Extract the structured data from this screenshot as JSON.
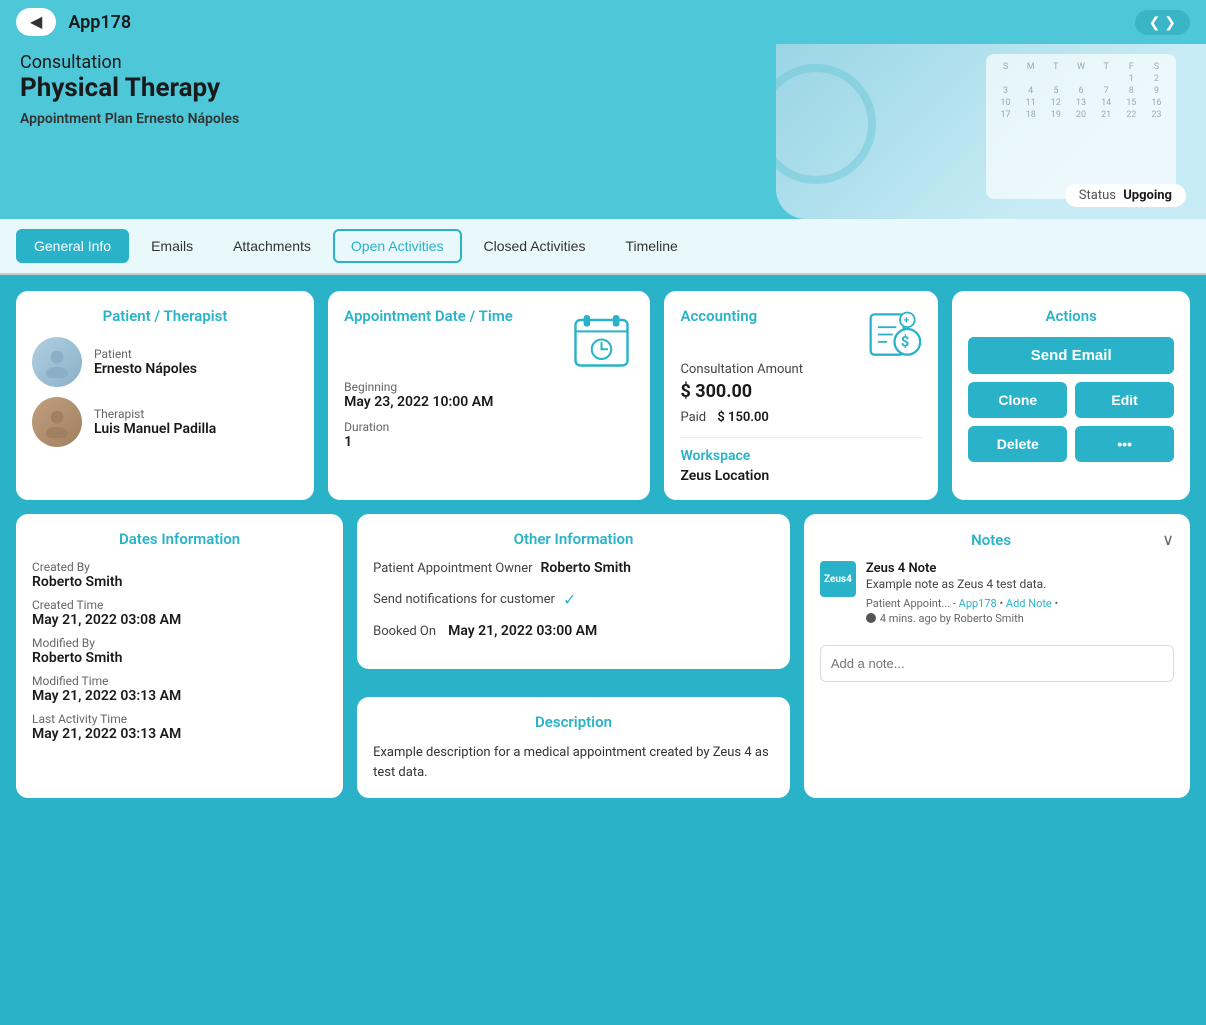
{
  "nav": {
    "back_label": "◀",
    "title": "App178",
    "arrows": "❮  ❯"
  },
  "header": {
    "subtitle": "Consultation",
    "title": "Physical Therapy",
    "plan_label": "Appointment Plan",
    "plan_value": "Ernesto Nápoles",
    "status_label": "Status",
    "status_value": "Upgoing"
  },
  "tabs": [
    {
      "id": "general",
      "label": "General Info",
      "state": "active"
    },
    {
      "id": "emails",
      "label": "Emails",
      "state": "normal"
    },
    {
      "id": "attachments",
      "label": "Attachments",
      "state": "normal"
    },
    {
      "id": "open-activities",
      "label": "Open Activities",
      "state": "outlined"
    },
    {
      "id": "closed-activities",
      "label": "Closed Activities",
      "state": "normal"
    },
    {
      "id": "timeline",
      "label": "Timeline",
      "state": "normal"
    }
  ],
  "patient_therapist": {
    "section_title": "Patient / Therapist",
    "patient_role": "Patient",
    "patient_name": "Ernesto Nápoles",
    "therapist_role": "Therapist",
    "therapist_name": "Luis Manuel Padilla"
  },
  "appointment": {
    "section_title": "Appointment Date / Time",
    "beginning_label": "Beginning",
    "beginning_value": "May 23, 2022 10:00 AM",
    "duration_label": "Duration",
    "duration_value": "1"
  },
  "accounting": {
    "section_title": "Accounting",
    "consult_label": "Consultation Amount",
    "consult_amount": "$ 300.00",
    "paid_label": "Paid",
    "paid_amount": "$ 150.00",
    "workspace_title": "Workspace",
    "workspace_value": "Zeus Location"
  },
  "actions": {
    "section_title": "Actions",
    "send_email": "Send Email",
    "clone": "Clone",
    "edit": "Edit",
    "delete": "Delete",
    "more": "•••"
  },
  "dates_info": {
    "section_title": "Dates Information",
    "created_by_label": "Created By",
    "created_by_value": "Roberto Smith",
    "created_time_label": "Created Time",
    "created_time_value": "May 21, 2022 03:08 AM",
    "modified_by_label": "Modified By",
    "modified_by_value": "Roberto Smith",
    "modified_time_label": "Modified Time",
    "modified_time_value": "May 21, 2022 03:13 AM",
    "last_activity_label": "Last Activity Time",
    "last_activity_value": "May 21, 2022 03:13 AM"
  },
  "other_info": {
    "section_title": "Other Information",
    "owner_label": "Patient Appointment Owner",
    "owner_value": "Roberto Smith",
    "notifications_label": "Send notifications for customer",
    "notifications_check": "✓",
    "booked_on_label": "Booked On",
    "booked_on_value": "May 21, 2022 03:00 AM"
  },
  "description": {
    "section_title": "Description",
    "text": "Example description for a medical appointment created by Zeus 4 as test data."
  },
  "notes": {
    "section_title": "Notes",
    "note_title": "Zeus 4 Note",
    "note_body": "Example note as  Zeus 4  test data.",
    "note_meta_app": "Patient Appoint...",
    "note_meta_sep": " - ",
    "note_meta_link": "App178",
    "note_meta_add": "Add Note",
    "note_timestamp": "4 mins. ago  by  Roberto Smith",
    "add_placeholder": "Add a note..."
  }
}
